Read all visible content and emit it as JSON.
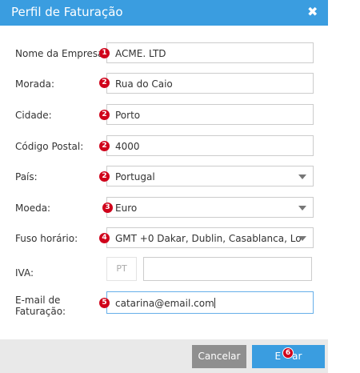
{
  "dialog": {
    "title": "Perfil de Faturação",
    "close_icon": "close-icon"
  },
  "form": {
    "company_name": {
      "label": "Nome da Empresa:",
      "value": "ACME. LTD",
      "badge": "1"
    },
    "address": {
      "label": "Morada:",
      "value": "Rua do Caio",
      "badge": "2"
    },
    "city": {
      "label": "Cidade:",
      "value": "Porto",
      "badge": "2"
    },
    "postal_code": {
      "label": "Código Postal:",
      "value": "4000",
      "badge": "2"
    },
    "country": {
      "label": "País:",
      "value": "Portugal",
      "badge": "2"
    },
    "currency": {
      "label": "Moeda:",
      "value": "Euro",
      "badge": "3"
    },
    "timezone": {
      "label": "Fuso horário:",
      "value": "GMT +0 Dakar, Dublin, Casablanca, Lo",
      "badge": "4"
    },
    "vat": {
      "label": "IVA:",
      "prefix": "PT",
      "value": ""
    },
    "billing_email": {
      "label_line1": "E-mail de",
      "label_line2": "Faturação:",
      "value": "catarina@email.com",
      "badge": "5"
    }
  },
  "footer": {
    "cancel_label": "Cancelar",
    "save_label_part1": "E",
    "save_label_part2": "ar",
    "save_badge": "6"
  },
  "colors": {
    "accent": "#3a9de0",
    "badge": "#d0021b",
    "cancel": "#8f8f8f"
  }
}
